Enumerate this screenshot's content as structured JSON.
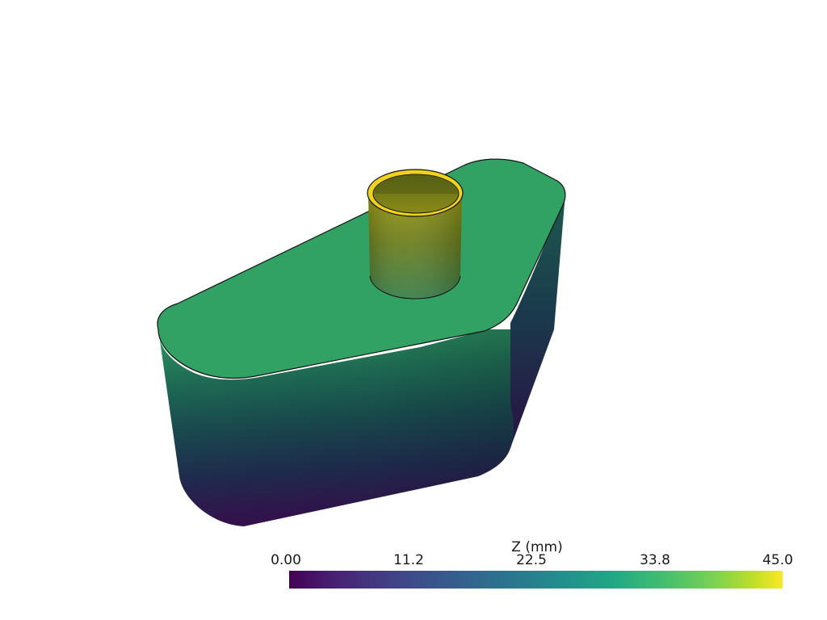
{
  "scalar_bar": {
    "title": "Z (mm)",
    "ticks": [
      "0.00",
      "11.2",
      "22.5",
      "33.8",
      "45.0"
    ],
    "range": [
      0,
      45
    ],
    "colormap": "viridis"
  },
  "colors": {
    "top_face": "#31a264",
    "tube_rim": "#f0d21a",
    "background": "#ffffff"
  }
}
